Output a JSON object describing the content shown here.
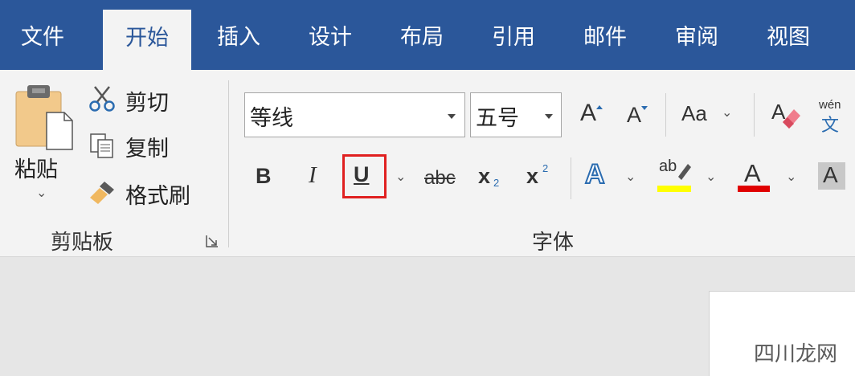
{
  "tabs": [
    {
      "label": "文件"
    },
    {
      "label": "开始"
    },
    {
      "label": "插入"
    },
    {
      "label": "设计"
    },
    {
      "label": "布局"
    },
    {
      "label": "引用"
    },
    {
      "label": "邮件"
    },
    {
      "label": "审阅"
    },
    {
      "label": "视图"
    }
  ],
  "active_tab": "开始",
  "clipboard": {
    "paste_label": "粘贴",
    "cut_label": "剪切",
    "copy_label": "复制",
    "format_painter_label": "格式刷",
    "group_label": "剪贴板"
  },
  "font": {
    "font_name": "等线",
    "font_size": "五号",
    "grow_font_glyph": "A",
    "shrink_font_glyph": "A",
    "change_case_glyph": "Aa",
    "phonetic_top": "wén",
    "phonetic_bottom": "文",
    "bold_glyph": "B",
    "italic_glyph": "I",
    "underline_glyph": "U",
    "strikethrough_glyph": "abc",
    "subscript_base": "x",
    "subscript_index": "2",
    "superscript_base": "x",
    "superscript_index": "2",
    "text_effect_glyph": "A",
    "highlight_glyph": "ab",
    "font_color_glyph": "A",
    "char_shading_glyph": "A",
    "group_label": "字体"
  },
  "colors": {
    "tab_bar": "#2b579a",
    "ribbon": "#f3f3f3",
    "underline_highlight_box": "#e02020",
    "highlight_yellow": "#ffff00",
    "font_color_red": "#e00000"
  },
  "watermark": "四川龙网"
}
